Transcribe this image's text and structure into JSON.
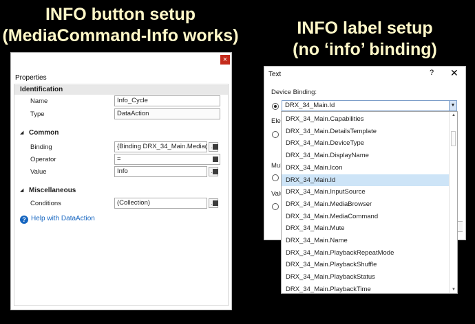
{
  "headings": {
    "left_line1": "INFO button setup",
    "left_line2": "(MediaCommand-Info works)",
    "right_line1": "INFO label setup",
    "right_line2": "(no ‘info’ binding)"
  },
  "properties": {
    "close_glyph": "×",
    "title": "Properties",
    "identification": {
      "header": "Identification",
      "name_label": "Name",
      "name_value": "Info_Cycle",
      "type_label": "Type",
      "type_value": "DataAction"
    },
    "common": {
      "header": "Common",
      "binding_label": "Binding",
      "binding_value": "{Binding DRX_34_Main.Media(",
      "operator_label": "Operator",
      "operator_value": "=",
      "value_label": "Value",
      "value_value": "Info"
    },
    "misc": {
      "header": "Miscellaneous",
      "conditions_label": "Conditions",
      "conditions_value": "(Collection)"
    },
    "dots_label": "...",
    "help_link": "Help with DataAction",
    "help_glyph": "?"
  },
  "text_dialog": {
    "title": "Text",
    "help_glyph": "?",
    "close_glyph": "✕",
    "device_binding_label": "Device Binding:",
    "selected_value": "DRX_34_Main.Id",
    "partial_labels": [
      "Elem",
      "Mul",
      "Valu"
    ],
    "dropdown_arrow": "▼",
    "list_items": [
      "DRX_34_Main.Capabilities",
      "DRX_34_Main.DetailsTemplate",
      "DRX_34_Main.DeviceType",
      "DRX_34_Main.DisplayName",
      "DRX_34_Main.Icon",
      "DRX_34_Main.Id",
      "DRX_34_Main.InputSource",
      "DRX_34_Main.MediaBrowser",
      "DRX_34_Main.MediaCommand",
      "DRX_34_Main.Mute",
      "DRX_34_Main.Name",
      "DRX_34_Main.PlaybackRepeatMode",
      "DRX_34_Main.PlaybackShuffle",
      "DRX_34_Main.PlaybackStatus",
      "DRX_34_Main.PlaybackTime"
    ],
    "highlighted_item": "DRX_34_Main.Id"
  }
}
